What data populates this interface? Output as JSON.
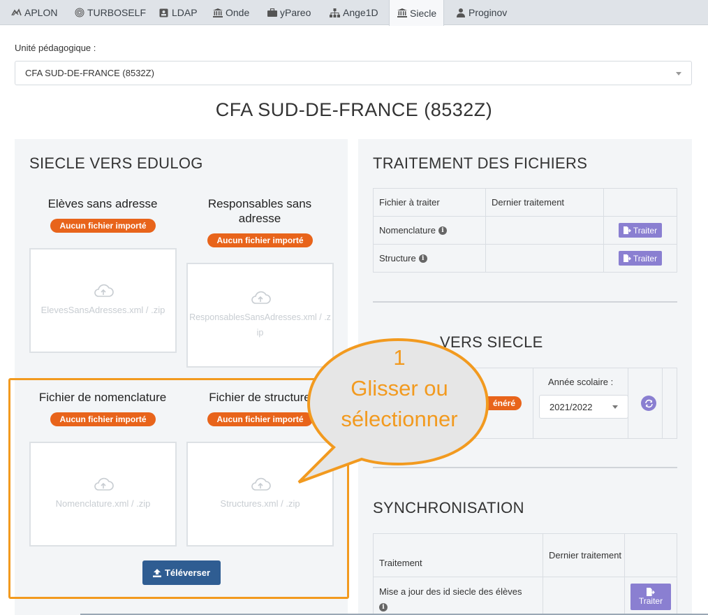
{
  "tabs": [
    {
      "label": "APLON",
      "icon": "aplon-icon"
    },
    {
      "label": "TURBOSELF",
      "icon": "fingerprint-icon"
    },
    {
      "label": "LDAP",
      "icon": "id-card-icon"
    },
    {
      "label": "Onde",
      "icon": "institution-icon"
    },
    {
      "label": "yPareo",
      "icon": "briefcase-icon"
    },
    {
      "label": "Ange1D",
      "icon": "sitemap-icon"
    },
    {
      "label": "Siecle",
      "icon": "institution-icon"
    },
    {
      "label": "Proginov",
      "icon": "user-tie-icon"
    }
  ],
  "active_tab": "Siecle",
  "selector": {
    "label": "Unité pédagogique :",
    "value": "CFA SUD-DE-FRANCE (8532Z)"
  },
  "page_title": "CFA SUD-DE-FRANCE (8532Z)",
  "left_panel": {
    "title": "SIECLE VERS EDULOG",
    "uploads": [
      {
        "title": "Elèves sans adresse",
        "badge": "Aucun fichier importé",
        "zone_text": "ElevesSansAdresses.xml / .zip"
      },
      {
        "title": "Responsables sans adresse",
        "badge": "Aucun fichier importé",
        "zone_text": "ResponsablesSansAdresses.xml / .zip"
      },
      {
        "title": "Fichier de nomenclature",
        "badge": "Aucun fichier importé",
        "zone_text": "Nomenclature.xml / .zip"
      },
      {
        "title": "Fichier de structure",
        "badge": "Aucun fichier importé",
        "zone_text": "Structures.xml / .zip"
      }
    ],
    "upload_button": "Téléverser"
  },
  "right_panel": {
    "traitement": {
      "title": "TRAITEMENT DES FICHIERS",
      "headers": [
        "Fichier à traiter",
        "Dernier traitement",
        ""
      ],
      "rows": [
        {
          "file": "Nomenclature",
          "last": "",
          "action": "Traiter"
        },
        {
          "file": "Structure",
          "last": "",
          "action": "Traiter"
        }
      ]
    },
    "export": {
      "title_visible": "VERS SIECLE",
      "title_prefix": "...",
      "badge_fragment": "énéré",
      "year_label": "Année scolaire :",
      "year_value": "2021/2022"
    },
    "sync": {
      "title": "SYNCHRONISATION",
      "headers": [
        "Traitement",
        "Dernier traitement",
        ""
      ],
      "rows": [
        {
          "label": "Mise a jour des id siecle des élèves",
          "last": "",
          "action": "Traiter"
        }
      ]
    }
  },
  "callout": {
    "number": "1",
    "line1": "Glisser ou",
    "line2": "sélectionner"
  },
  "colors": {
    "badge": "#e8641b",
    "highlight": "#f29a1f",
    "upload_btn": "#2f5d92",
    "traiter_btn": "#8a7fd1"
  }
}
